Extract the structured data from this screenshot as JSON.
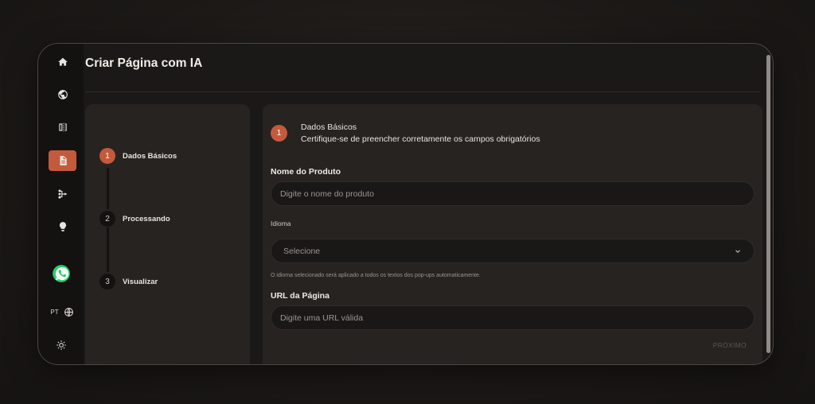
{
  "app": {
    "title": "Criar Página com IA"
  },
  "sidebar": {
    "items": [
      {
        "icon": "home-icon"
      },
      {
        "icon": "globe-icon"
      },
      {
        "icon": "split-view-icon"
      },
      {
        "icon": "document-icon",
        "active": true
      },
      {
        "icon": "flow-icon"
      },
      {
        "icon": "lightbulb-icon"
      }
    ],
    "whatsapp_icon": "whatsapp-icon",
    "language_label": "PT",
    "theme_icon": "sun-icon"
  },
  "steps": [
    {
      "number": "1",
      "label": "Dados Básicos",
      "active": true
    },
    {
      "number": "2",
      "label": "Processando",
      "active": false
    },
    {
      "number": "3",
      "label": "Visualizar",
      "active": false
    }
  ],
  "form": {
    "step_number": "1",
    "title": "Dados Básicos",
    "subtitle": "Certifique-se de preencher corretamente os campos obrigatórios",
    "product_name": {
      "label": "Nome do Produto",
      "placeholder": "Digite o nome do produto",
      "value": ""
    },
    "language": {
      "label": "Idioma",
      "selected": "Selecione",
      "hint": "O idioma selecionado será aplicado a todos os textos dos pop-ups automaticamente."
    },
    "page_url": {
      "label": "URL da Página",
      "placeholder": "Digite uma URL válida",
      "value": ""
    },
    "next_label": "PRÓXIMO"
  },
  "colors": {
    "accent": "#c45a3c",
    "background": "#1b1917",
    "panel": "#272321"
  }
}
